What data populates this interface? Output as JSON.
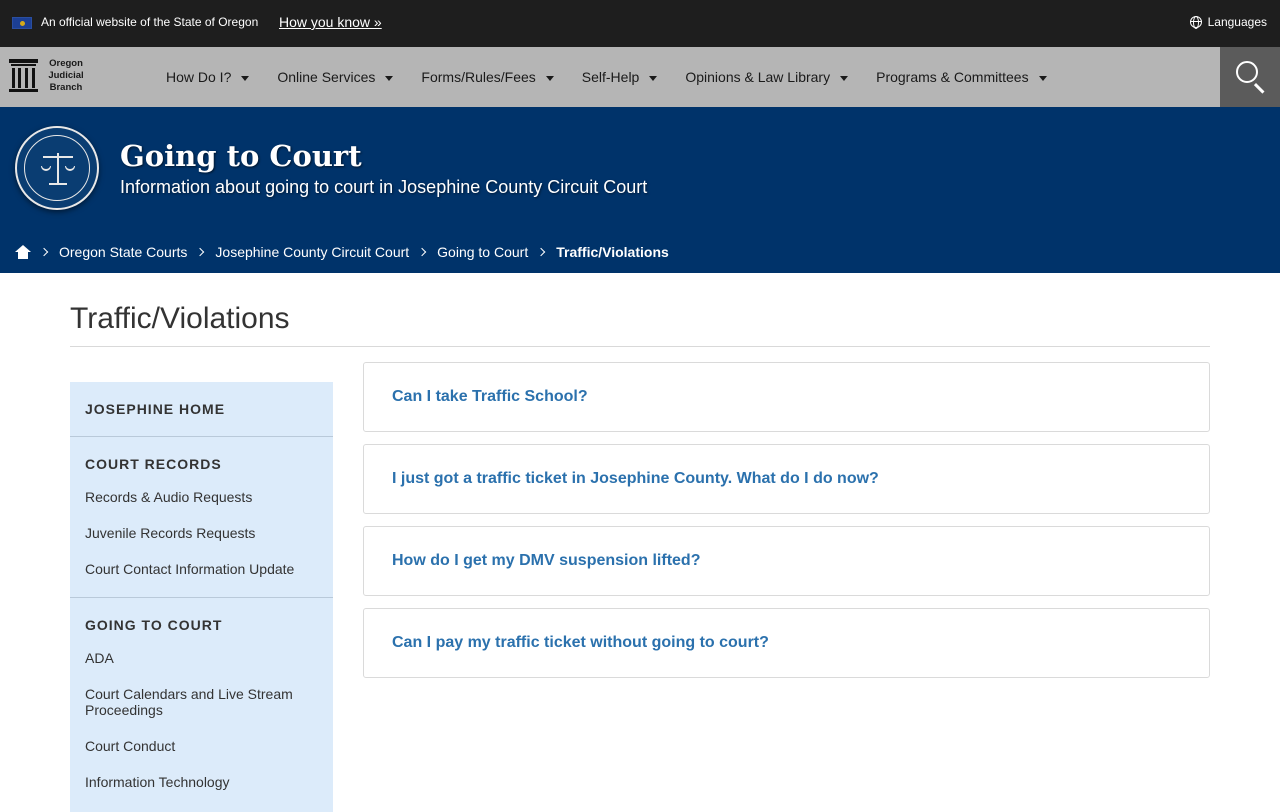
{
  "banner": {
    "official_text": "An official website of the State of Oregon",
    "how_you_know": "How you know »",
    "languages": "Languages"
  },
  "nav": {
    "logo_text": "Oregon Judicial Branch",
    "items": [
      {
        "label": "How Do I?"
      },
      {
        "label": "Online Services"
      },
      {
        "label": "Forms/Rules/Fees"
      },
      {
        "label": "Self-Help"
      },
      {
        "label": "Opinions & Law Library"
      },
      {
        "label": "Programs & Committees"
      }
    ]
  },
  "hero": {
    "title": "Going to Court",
    "subtitle": "Information about going to court in Josephine County Circuit Court"
  },
  "breadcrumb": [
    {
      "label": "Oregon State Courts"
    },
    {
      "label": "Josephine County Circuit Court"
    },
    {
      "label": "Going to Court"
    },
    {
      "label": "Traffic/Violations"
    }
  ],
  "page_title": "Traffic/Violations",
  "sidebar": {
    "home": "JOSEPHINE HOME",
    "records_head": "COURT RECORDS",
    "records_links": [
      "Records & Audio Requests",
      "Juvenile Records Requests",
      "Court Contact Information Update"
    ],
    "going_head": "GOING TO COURT",
    "going_links": [
      "ADA",
      "Court Calendars and Live Stream Proceedings",
      "Court Conduct",
      "Information Technology"
    ]
  },
  "faqs": [
    "Can I take Traffic School?",
    "I just got a traffic ticket in Josephine County. What do I do now?",
    "How do I get my DMV suspension lifted?",
    "Can I pay my traffic ticket without going to court?"
  ]
}
